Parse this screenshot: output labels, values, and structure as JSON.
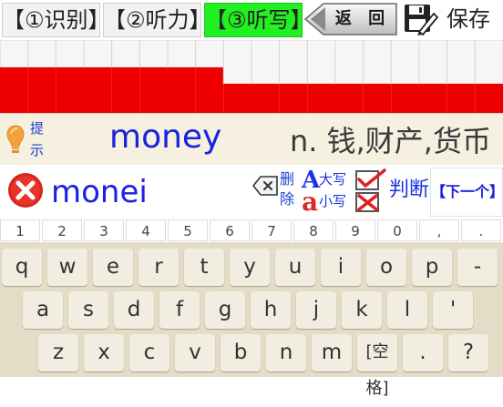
{
  "tabs": [
    {
      "label": "【①识别】",
      "active": false
    },
    {
      "label": "【②听力】",
      "active": false
    },
    {
      "label": "【③听写】",
      "active": true
    }
  ],
  "back_label": "返 回",
  "save_label": "保存",
  "progress": {
    "columns": 18,
    "completed": 8
  },
  "hint_label": "提示",
  "word": "money",
  "meaning": "n. 钱,财产,货币",
  "answer": "monei",
  "delete_label": "删除",
  "case_upper": "大写",
  "case_lower": "小写",
  "judge_label": "判断",
  "next_label": "【下一个】",
  "keyboard": {
    "numbers": [
      "1",
      "2",
      "3",
      "4",
      "5",
      "6",
      "7",
      "8",
      "9",
      "0",
      ",",
      "."
    ],
    "row1": [
      "q",
      "w",
      "e",
      "r",
      "t",
      "y",
      "u",
      "i",
      "o",
      "p",
      "-"
    ],
    "row2": [
      "a",
      "s",
      "d",
      "f",
      "g",
      "h",
      "j",
      "k",
      "l",
      "'"
    ],
    "row3": [
      "z",
      "x",
      "c",
      "v",
      "b",
      "n",
      "m",
      "[空格]",
      ".",
      "?"
    ]
  },
  "colors": {
    "active_tab": "#22f022",
    "progress_fill": "#ee0000",
    "word_blue": "#1a22e0"
  }
}
